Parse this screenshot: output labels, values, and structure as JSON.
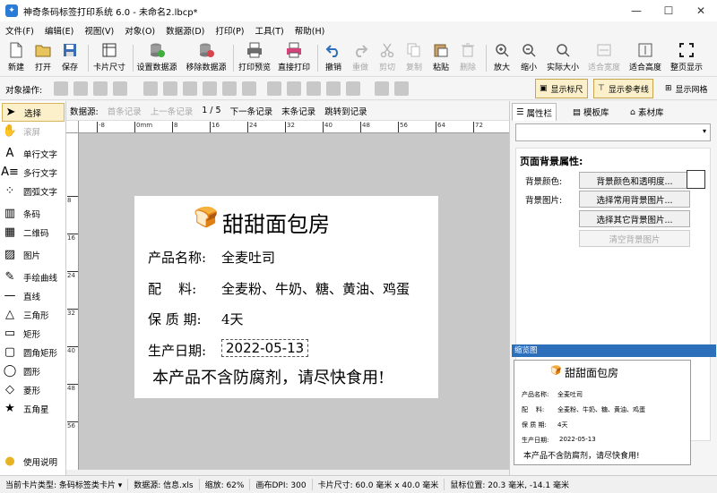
{
  "window": {
    "title": "神奇条码标签打印系统 6.0 - 未命名2.lbcp*",
    "minimize": "—",
    "maximize": "☐",
    "close": "✕"
  },
  "menu": [
    "文件(F)",
    "编辑(E)",
    "视图(V)",
    "对象(O)",
    "数据源(D)",
    "打印(P)",
    "工具(T)",
    "帮助(H)"
  ],
  "toolbar": {
    "new": "新建",
    "open": "打开",
    "save": "保存",
    "card_size": "卡片尺寸",
    "set_datasource": "设置数据源",
    "remove_datasource": "移除数据源",
    "print_preview": "打印预览",
    "print_direct": "直接打印",
    "undo": "撤销",
    "redo": "重做",
    "cut": "剪切",
    "copy": "复制",
    "paste": "粘贴",
    "delete": "删除",
    "zoom_in": "放大",
    "zoom_out": "缩小",
    "actual_size": "实际大小",
    "fit_width": "适合宽度",
    "fit_height": "适合高度",
    "fit_page": "整页显示"
  },
  "ops": {
    "label": "对象操作:",
    "show_ruler": "显示标尺",
    "show_guides": "显示参考线",
    "show_grid": "显示网格"
  },
  "tools": [
    "选择",
    "滚屏",
    "单行文字",
    "多行文字",
    "圆弧文字",
    "条码",
    "二维码",
    "图片",
    "手绘曲线",
    "直线",
    "三角形",
    "矩形",
    "圆角矩形",
    "圆形",
    "菱形",
    "五角星",
    "使用说明"
  ],
  "nav": {
    "label": "数据源:",
    "first": "首条记录",
    "prev": "上一条记录",
    "page": "1 / 5",
    "next": "下一条记录",
    "last": "末条记录",
    "jump": "跳转到记录"
  },
  "ruler": {
    "h_ticks": [
      "-8",
      "0mm",
      "8",
      "16",
      "24",
      "32",
      "40",
      "48",
      "56",
      "64",
      "72"
    ],
    "v_ticks": [
      "8",
      "16",
      "24",
      "32",
      "40",
      "48",
      "56"
    ]
  },
  "label": {
    "shop": "甜甜面包房",
    "name_key": "产品名称:",
    "name_val": "全麦吐司",
    "ingr_key": "配    料:",
    "ingr_val": "全麦粉、牛奶、糖、黄油、鸡蛋",
    "shelf_key": "保 质 期:",
    "shelf_val": "4天",
    "date_key": "生产日期:",
    "date_val": "2022-05-13",
    "notice": "本产品不含防腐剂，请尽快食用!"
  },
  "right": {
    "tabs": [
      "属性栏",
      "模板库",
      "素材库"
    ],
    "section": "页面背景属性:",
    "bg_color_label": "背景颜色:",
    "bg_color_btn": "背景颜色和透明度...",
    "bg_image_label": "背景图片:",
    "bg_common_btn": "选择常用背景图片...",
    "bg_other_btn": "选择其它背景图片...",
    "bg_clear_btn": "清空背景图片",
    "preview_title": "缩览图"
  },
  "status": {
    "card_type": "当前卡片类型: 条码标签类卡片 ▾",
    "datasource": "数据源: 信息.xls",
    "zoom": "缩放: 62%",
    "dpi": "画布DPI: 300",
    "size": "卡片尺寸: 60.0 毫米 x 40.0 毫米",
    "mouse": "鼠标位置: 20.3 毫米, -14.1 毫米"
  },
  "colors": {
    "accent": "#2e6fbc",
    "toggle_bg": "#fbf0c9",
    "canvas": "#c8c8c8"
  }
}
